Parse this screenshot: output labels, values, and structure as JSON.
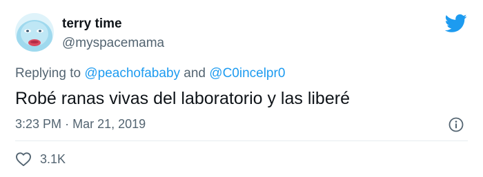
{
  "author": {
    "display_name": "terry time",
    "handle": "@myspacemama",
    "avatar": "avatar-photo"
  },
  "reply": {
    "prefix": "Replying to",
    "mentions": [
      "@peachofababy",
      "@C0incelpr0"
    ],
    "conjunction": "and"
  },
  "tweet": {
    "text": "Robé ranas vivas del laboratorio y las liberé"
  },
  "meta": {
    "time": "3:23 PM",
    "separator": "·",
    "date": "Mar 21, 2019"
  },
  "engagement": {
    "likes": "3.1K"
  },
  "icons": {
    "brand": "twitter-bird-icon",
    "info": "info-icon",
    "like": "heart-icon"
  },
  "colors": {
    "brand": "#1d9bf0",
    "text": "#0f1419",
    "secondary": "#536471"
  }
}
